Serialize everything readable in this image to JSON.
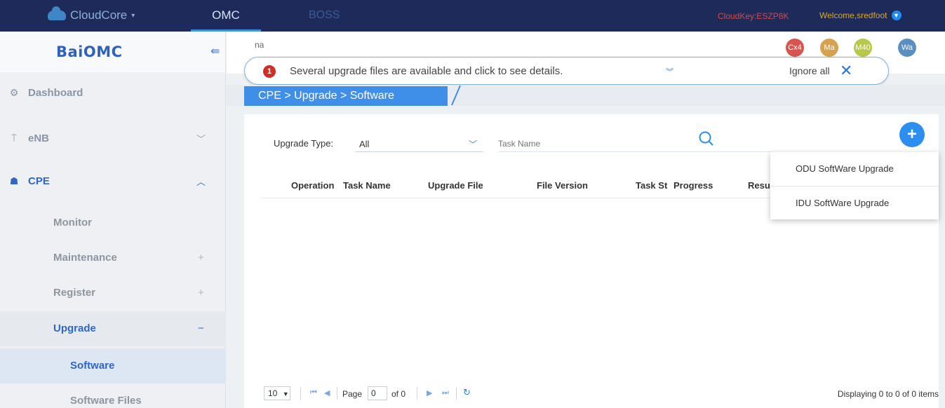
{
  "topbar": {
    "brand": "CloudCore",
    "nav": [
      {
        "label": "OMC"
      },
      {
        "label": "BOSS"
      }
    ],
    "cloudkey": "CloudKey:ESZP8K",
    "welcome": "Welcome,sredfoot"
  },
  "sidebar": {
    "logo": "BaiOMC",
    "items": [
      {
        "label": "Dashboard"
      },
      {
        "label": "eNB"
      },
      {
        "label": "CPE"
      }
    ],
    "cpe_sub": [
      {
        "label": "Monitor"
      },
      {
        "label": "Maintenance"
      },
      {
        "label": "Register"
      },
      {
        "label": "Upgrade"
      }
    ],
    "upgrade_sub": [
      {
        "label": "Software"
      },
      {
        "label": "Software Files"
      }
    ]
  },
  "header": {
    "partial_text": "na",
    "avatars": [
      {
        "label": "Cx4",
        "color": "#d9534f"
      },
      {
        "label": "Ma",
        "color": "#d7a24d"
      },
      {
        "label": "M40",
        "color": "#b7c84a"
      },
      {
        "label": "Wa",
        "color": "#5a8fc4"
      }
    ]
  },
  "notification": {
    "count": "1",
    "message": "Several upgrade files are available and click to see details.",
    "ignore_label": "Ignore all"
  },
  "breadcrumb": "CPE > Upgrade > Software",
  "filters": {
    "type_label": "Upgrade Type:",
    "type_value": "All",
    "task_placeholder": "Task Name"
  },
  "table": {
    "columns": [
      "Operation",
      "Task Name",
      "Upgrade File",
      "File Version",
      "Task St",
      "Progress",
      "Resu"
    ]
  },
  "add_menu": {
    "items": [
      {
        "label": "ODU SoftWare Upgrade"
      },
      {
        "label": "IDU SoftWare Upgrade"
      }
    ]
  },
  "pager": {
    "page_size": "10",
    "page_label": "Page",
    "page_value": "0",
    "of_label": "of 0",
    "display": "Displaying 0 to 0 of 0 items"
  },
  "colors": {
    "topbar": "#1e2a5a",
    "accent": "#3f8fe8",
    "badge": "#d42d26"
  }
}
